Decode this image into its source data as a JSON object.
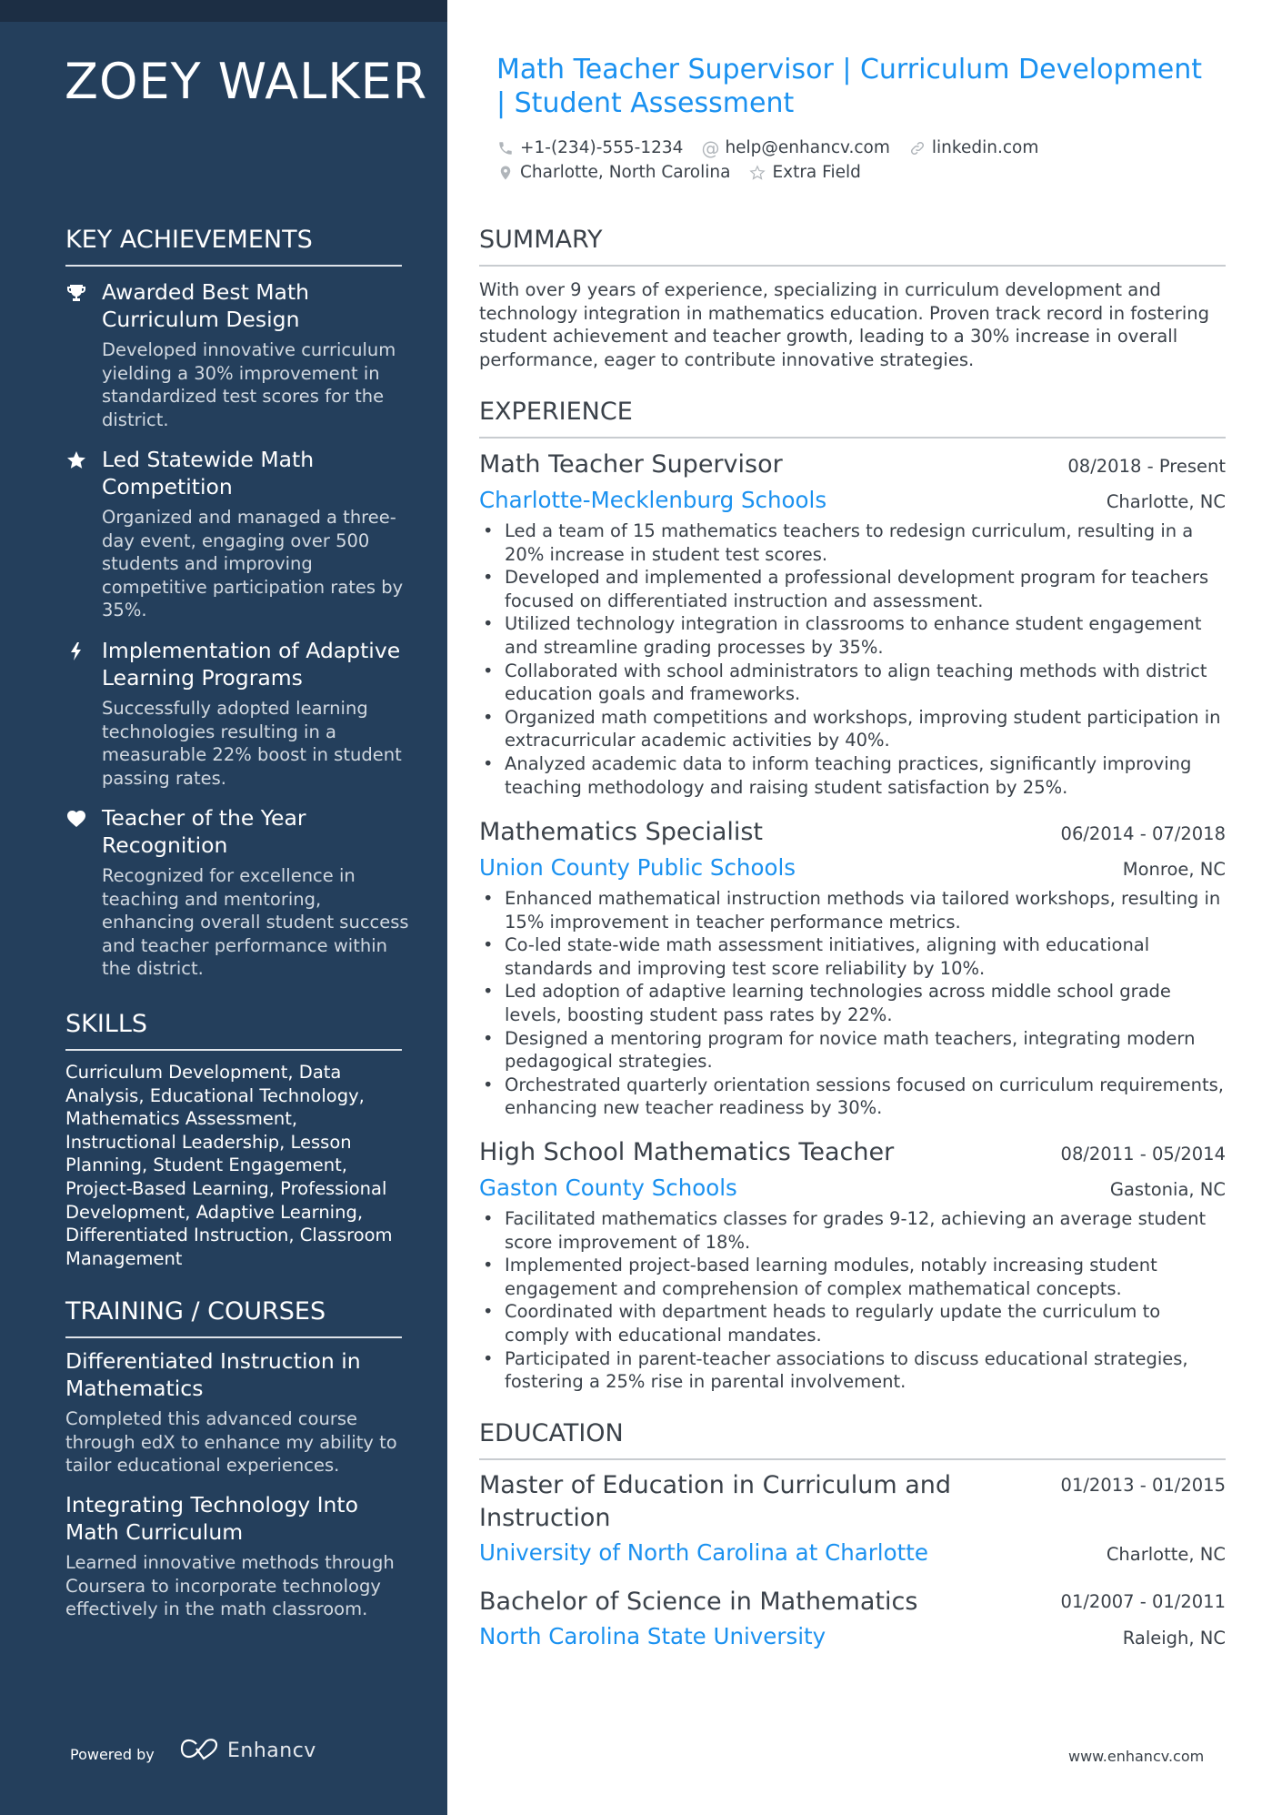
{
  "name": "ZOEY WALKER",
  "headline": "Math Teacher Supervisor | Curriculum Development | Student Assessment",
  "contacts": {
    "phone": "+1-(234)-555-1234",
    "email": "help@enhancv.com",
    "website": "linkedin.com",
    "location": "Charlotte, North Carolina",
    "extra": "Extra Field"
  },
  "colors": {
    "sidebar": "#243f5c",
    "accent": "#1a91f0",
    "text": "#3a4149"
  },
  "sidebar": {
    "achievements_title": "KEY ACHIEVEMENTS",
    "achievements": [
      {
        "icon": "trophy-icon",
        "title": "Awarded Best Math Curriculum Design",
        "description": "Developed innovative curriculum yielding a 30% improvement in standardized test scores for the district."
      },
      {
        "icon": "star-icon",
        "title": "Led Statewide Math Competition",
        "description": "Organized and managed a three-day event, engaging over 500 students and improving competitive participation rates by 35%."
      },
      {
        "icon": "bolt-icon",
        "title": "Implementation of Adaptive Learning Programs",
        "description": "Successfully adopted learning technologies resulting in a measurable 22% boost in student passing rates."
      },
      {
        "icon": "heart-icon",
        "title": "Teacher of the Year Recognition",
        "description": "Recognized for excellence in teaching and mentoring, enhancing overall student success and teacher performance within the district."
      }
    ],
    "skills_title": "SKILLS",
    "skills": "Curriculum Development, Data Analysis, Educational Technology, Mathematics Assessment, Instructional Leadership, Lesson Planning, Student Engagement, Project-Based Learning, Professional Development, Adaptive Learning, Differentiated Instruction, Classroom Management",
    "training_title": "TRAINING / COURSES",
    "courses": [
      {
        "title": "Differentiated Instruction in Mathematics",
        "description": "Completed this advanced course through edX to enhance my ability to tailor educational experiences."
      },
      {
        "title": "Integrating Technology Into Math Curriculum",
        "description": "Learned innovative methods through Coursera to incorporate technology effectively in the math classroom."
      }
    ],
    "powered_by": "Powered by",
    "brand": "Enhancv"
  },
  "main": {
    "summary_title": "SUMMARY",
    "summary": "With over 9 years of experience, specializing in curriculum development and technology integration in mathematics education. Proven track record in fostering student achievement and teacher growth, leading to a 30% increase in overall performance, eager to contribute innovative strategies.",
    "experience_title": "EXPERIENCE",
    "jobs": [
      {
        "role": "Math Teacher Supervisor",
        "dates": "08/2018 - Present",
        "company": "Charlotte-Mecklenburg Schools",
        "location": "Charlotte, NC",
        "bullets": [
          "Led a team of 15 mathematics teachers to redesign curriculum, resulting in a 20% increase in student test scores.",
          "Developed and implemented a professional development program for teachers focused on differentiated instruction and assessment.",
          "Utilized technology integration in classrooms to enhance student engagement and streamline grading processes by 35%.",
          "Collaborated with school administrators to align teaching methods with district education goals and frameworks.",
          "Organized math competitions and workshops, improving student participation in extracurricular academic activities by 40%.",
          "Analyzed academic data to inform teaching practices, significantly improving teaching methodology and raising student satisfaction by 25%."
        ]
      },
      {
        "role": "Mathematics Specialist",
        "dates": "06/2014 - 07/2018",
        "company": "Union County Public Schools",
        "location": "Monroe, NC",
        "bullets": [
          "Enhanced mathematical instruction methods via tailored workshops, resulting in 15% improvement in teacher performance metrics.",
          "Co-led state-wide math assessment initiatives, aligning with educational standards and improving test score reliability by 10%.",
          "Led adoption of adaptive learning technologies across middle school grade levels, boosting student pass rates by 22%.",
          "Designed a mentoring program for novice math teachers, integrating modern pedagogical strategies.",
          "Orchestrated quarterly orientation sessions focused on curriculum requirements, enhancing new teacher readiness by 30%."
        ]
      },
      {
        "role": "High School Mathematics Teacher",
        "dates": "08/2011 - 05/2014",
        "company": "Gaston County Schools",
        "location": "Gastonia, NC",
        "bullets": [
          "Facilitated mathematics classes for grades 9-12, achieving an average student score improvement of 18%.",
          "Implemented project-based learning modules, notably increasing student engagement and comprehension of complex mathematical concepts.",
          "Coordinated with department heads to regularly update the curriculum to comply with educational mandates.",
          "Participated in parent-teacher associations to discuss educational strategies, fostering a 25% rise in parental involvement."
        ]
      }
    ],
    "education_title": "EDUCATION",
    "education": [
      {
        "degree": "Master of Education in Curriculum and Instruction",
        "dates": "01/2013 - 01/2015",
        "school": "University of North Carolina at Charlotte",
        "location": "Charlotte, NC"
      },
      {
        "degree": "Bachelor of Science in Mathematics",
        "dates": "01/2007 - 01/2011",
        "school": "North Carolina State University",
        "location": "Raleigh, NC"
      }
    ],
    "footer_url": "www.enhancv.com"
  }
}
